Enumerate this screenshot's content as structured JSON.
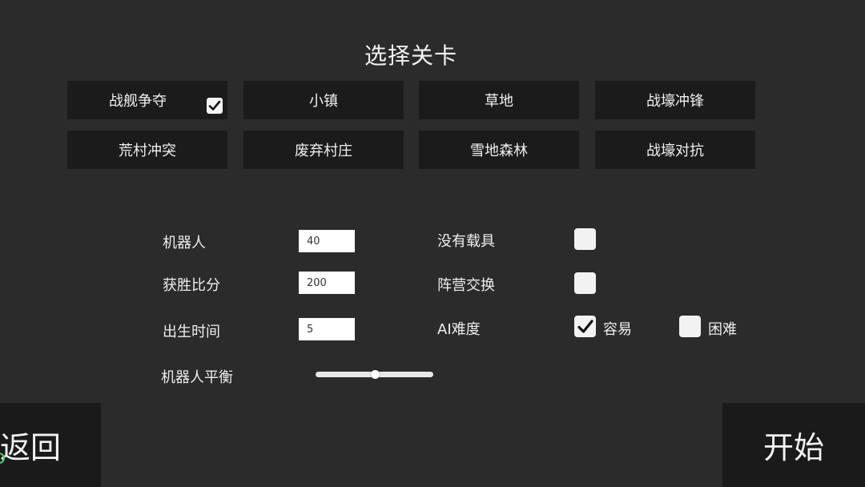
{
  "title": "选择关卡",
  "levels": [
    {
      "label": "战舰争夺",
      "selected": true
    },
    {
      "label": "小镇",
      "selected": false
    },
    {
      "label": "草地",
      "selected": false
    },
    {
      "label": "战壕冲锋",
      "selected": false
    },
    {
      "label": "荒村冲突",
      "selected": false
    },
    {
      "label": "废弃村庄",
      "selected": false
    },
    {
      "label": "雪地森林",
      "selected": false
    },
    {
      "label": "战壕对抗",
      "selected": false
    }
  ],
  "settings": {
    "bots_label": "机器人",
    "bots_value": "40",
    "win_score_label": "获胜比分",
    "win_score_value": "200",
    "spawn_time_label": "出生时间",
    "spawn_time_value": "5",
    "bot_balance_label": "机器人平衡",
    "bot_balance_level": 0.5,
    "no_vehicles_label": "没有载具",
    "no_vehicles_checked": false,
    "team_swap_label": "阵营交换",
    "team_swap_checked": false,
    "ai_difficulty_label": "AI难度",
    "easy_label": "容易",
    "easy_checked": true,
    "hard_label": "困难",
    "hard_checked": false
  },
  "buttons": {
    "back_label": "返回",
    "start_label": "开始"
  },
  "icons": {
    "checkmark": "checkmark-icon"
  },
  "colors": {
    "background": "#2b2b2b",
    "button_bg": "#1b1b1b",
    "text": "#f0f0f0",
    "accent_green": "#3fd35a"
  }
}
